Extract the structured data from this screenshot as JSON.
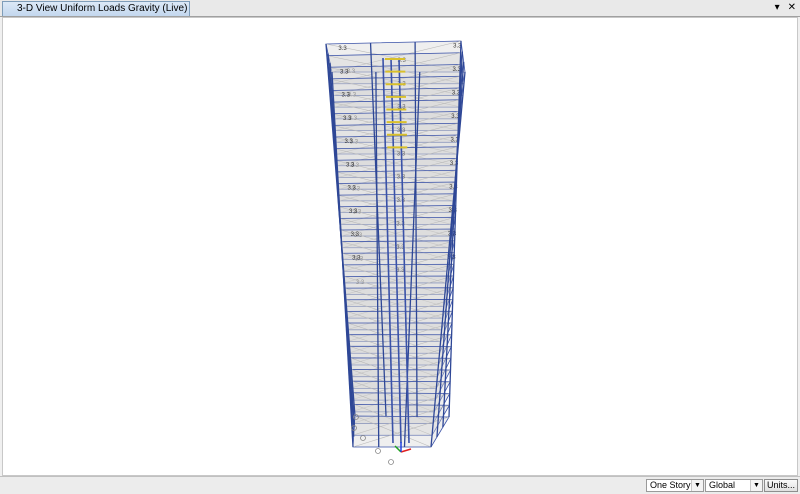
{
  "tab": {
    "title": "3-D View  Uniform Loads Gravity  (Live)"
  },
  "tab_controls": {
    "dropdown": "▾",
    "close": "✕"
  },
  "model": {
    "load_label": "3.3",
    "story_count": 32
  },
  "status": {
    "story_select": "One Story",
    "coord_select": "Global",
    "units_button": "Units..."
  },
  "colors": {
    "column": "#2e4796",
    "beam": "#3a52a8",
    "slab_fill": "#d0d0d0",
    "brace_yellow": "#d9c02a",
    "axis_x": "#e02020",
    "axis_y": "#20a020",
    "axis_z": "#2040e0"
  }
}
